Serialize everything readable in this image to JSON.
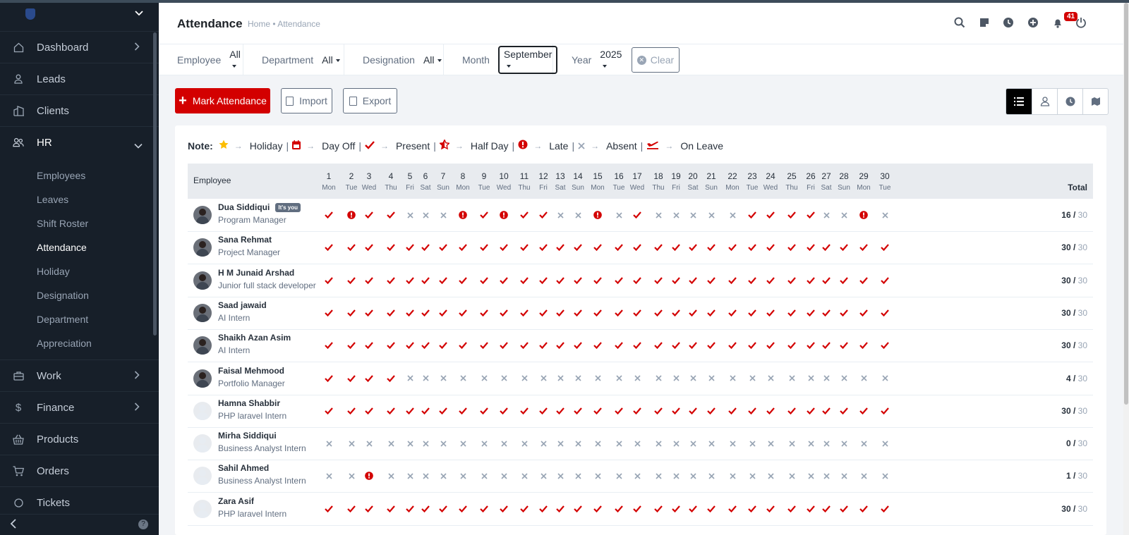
{
  "sidebar": {
    "items": [
      {
        "label": "Dashboard",
        "icon": "house-icon",
        "arrow": "right"
      },
      {
        "label": "Leads",
        "icon": "person-icon",
        "arrow": ""
      },
      {
        "label": "Clients",
        "icon": "building-icon",
        "arrow": ""
      },
      {
        "label": "HR",
        "icon": "people-icon",
        "arrow": "down"
      }
    ],
    "hr_sub": [
      "Employees",
      "Leaves",
      "Shift Roster",
      "Attendance",
      "Holiday",
      "Designation",
      "Department",
      "Appreciation"
    ],
    "active_sub": "Attendance",
    "items_after": [
      {
        "label": "Work",
        "icon": "briefcase-icon",
        "arrow": "right"
      },
      {
        "label": "Finance",
        "icon": "dollar-icon",
        "arrow": "right"
      },
      {
        "label": "Products",
        "icon": "basket-icon",
        "arrow": ""
      },
      {
        "label": "Orders",
        "icon": "cart-icon",
        "arrow": ""
      },
      {
        "label": "Tickets",
        "icon": "ticket-icon",
        "arrow": ""
      }
    ],
    "help": "?"
  },
  "header": {
    "title": "Attendance",
    "breadcrumb": "Home • Attendance",
    "notification_count": "41"
  },
  "filters": {
    "employee_label": "Employee",
    "employee_value": "All",
    "department_label": "Department",
    "department_value": "All",
    "designation_label": "Designation",
    "designation_value": "All",
    "month_label": "Month",
    "month_value": "September",
    "year_label": "Year",
    "year_value": "2025",
    "clear_label": "Clear"
  },
  "actions": {
    "mark_attendance": "Mark Attendance",
    "import": "Import",
    "export": "Export"
  },
  "note": {
    "title": "Note:",
    "holiday": "Holiday",
    "day_off": "Day Off",
    "present": "Present",
    "half_day": "Half Day",
    "late": "Late",
    "absent": "Absent",
    "on_leave": "On Leave"
  },
  "table": {
    "employee_header": "Employee",
    "total_header": "Total",
    "days": [
      {
        "d": "1",
        "w": "Mon"
      },
      {
        "d": "2",
        "w": "Tue"
      },
      {
        "d": "3",
        "w": "Wed"
      },
      {
        "d": "4",
        "w": "Thu"
      },
      {
        "d": "5",
        "w": "Fri"
      },
      {
        "d": "6",
        "w": "Sat"
      },
      {
        "d": "7",
        "w": "Sun"
      },
      {
        "d": "8",
        "w": "Mon"
      },
      {
        "d": "9",
        "w": "Tue"
      },
      {
        "d": "10",
        "w": "Wed"
      },
      {
        "d": "11",
        "w": "Thu"
      },
      {
        "d": "12",
        "w": "Fri"
      },
      {
        "d": "13",
        "w": "Sat"
      },
      {
        "d": "14",
        "w": "Sun"
      },
      {
        "d": "15",
        "w": "Mon"
      },
      {
        "d": "16",
        "w": "Tue"
      },
      {
        "d": "17",
        "w": "Wed"
      },
      {
        "d": "18",
        "w": "Thu"
      },
      {
        "d": "19",
        "w": "Fri"
      },
      {
        "d": "20",
        "w": "Sat"
      },
      {
        "d": "21",
        "w": "Sun"
      },
      {
        "d": "22",
        "w": "Mon"
      },
      {
        "d": "23",
        "w": "Tue"
      },
      {
        "d": "24",
        "w": "Wed"
      },
      {
        "d": "25",
        "w": "Thu"
      },
      {
        "d": "26",
        "w": "Fri"
      },
      {
        "d": "27",
        "w": "Sat"
      },
      {
        "d": "28",
        "w": "Sun"
      },
      {
        "d": "29",
        "w": "Mon"
      },
      {
        "d": "30",
        "w": "Tue"
      }
    ],
    "rows": [
      {
        "name": "Dua Siddiqui",
        "badge": "It's you",
        "designation": "Program Manager",
        "photo": true,
        "present": "16",
        "total": "30",
        "marks": "PLPPAAALPLPPAALAPAAAAAPPPPAALA"
      },
      {
        "name": "Sana Rehmat",
        "badge": "",
        "designation": "Project Manager",
        "photo": true,
        "present": "30",
        "total": "30",
        "marks": "PPPPPPPPPPPPPPPPPPPPPPPPPPPPPP"
      },
      {
        "name": "H M Junaid Arshad",
        "badge": "",
        "designation": "Junior full stack developer",
        "photo": true,
        "present": "30",
        "total": "30",
        "marks": "PPPPPPPPPPPPPPPPPPPPPPPPPPPPPP"
      },
      {
        "name": "Saad jawaid",
        "badge": "",
        "designation": "AI Intern",
        "photo": true,
        "present": "30",
        "total": "30",
        "marks": "PPPPPPPPPPPPPPPPPPPPPPPPPPPPPP"
      },
      {
        "name": "Shaikh Azan Asim",
        "badge": "",
        "designation": "AI Intern",
        "photo": true,
        "present": "30",
        "total": "30",
        "marks": "PPPPPPPPPPPPPPPPPPPPPPPPPPPPPP"
      },
      {
        "name": "Faisal Mehmood",
        "badge": "",
        "designation": "Portfolio Manager",
        "photo": true,
        "present": "4",
        "total": "30",
        "marks": "PPPPAAAAAAAAAAAAAAAAAAAAAAAAAA"
      },
      {
        "name": "Hamna Shabbir",
        "badge": "",
        "designation": "PHP laravel Intern",
        "photo": false,
        "present": "30",
        "total": "30",
        "marks": "PPPPPPPPPPPPPPPPPPPPPPPPPPPPPP"
      },
      {
        "name": "Mirha Siddiqui",
        "badge": "",
        "designation": "Business Analyst Intern",
        "photo": false,
        "present": "0",
        "total": "30",
        "marks": "AAAAAAAAAAAAAAAAAAAAAAAAAAAAAA"
      },
      {
        "name": "Sahil Ahmed",
        "badge": "",
        "designation": "Business Analyst Intern",
        "photo": false,
        "present": "1",
        "total": "30",
        "marks": "AALAAAAAAAAAAAAAAAAAAAAAAAAAAA"
      },
      {
        "name": "Zara Asif",
        "badge": "",
        "designation": "PHP laravel Intern",
        "photo": false,
        "present": "30",
        "total": "30",
        "marks": "PPPPPPPPPPPPPPPPPPPPPPPPPPPPPP"
      }
    ]
  },
  "colors": {
    "accent": "#d30000",
    "sidebar": "#171f29",
    "absent": "#99a5b5",
    "holiday": "#fcbd01"
  }
}
